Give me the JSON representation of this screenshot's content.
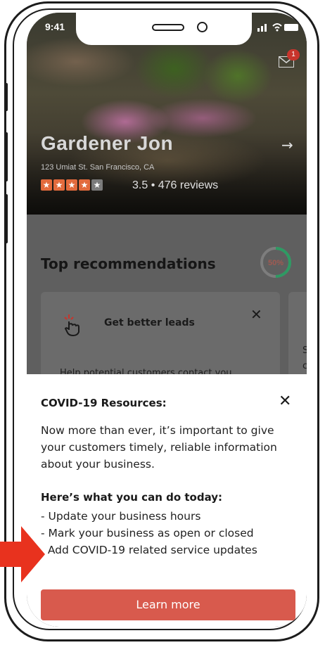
{
  "status_bar": {
    "time": "9:41"
  },
  "notifications": {
    "badge_count": "1"
  },
  "business": {
    "name": "Gardener Jon",
    "address": "123 Umiat St. San Francisco, CA",
    "rating": "3.5",
    "rating_value": 3.5,
    "reviews_text": "• 476 reviews"
  },
  "recommendations": {
    "title": "Top recommendations",
    "progress_label": "50%",
    "progress_value": 0.5,
    "card": {
      "title": "Get better leads",
      "description": "Help potential customers contact you."
    },
    "card2_partial": {
      "line1": "S",
      "line2": "c"
    }
  },
  "covid_sheet": {
    "title": "COVID-19 Resources:",
    "body": "Now more than ever, it’s important to give your customers timely, reliable information about your business.",
    "subtitle": "Here’s what you can do today:",
    "items": [
      "- Update your business hours",
      "- Mark your business as open or closed",
      "  Add COVID-19 related service updates"
    ],
    "cta": "Learn more"
  },
  "colors": {
    "brand_red": "#d85a4d",
    "star_red": "#e26a3c",
    "progress_green": "#2e9a63",
    "annotation_red": "#e8321e"
  }
}
